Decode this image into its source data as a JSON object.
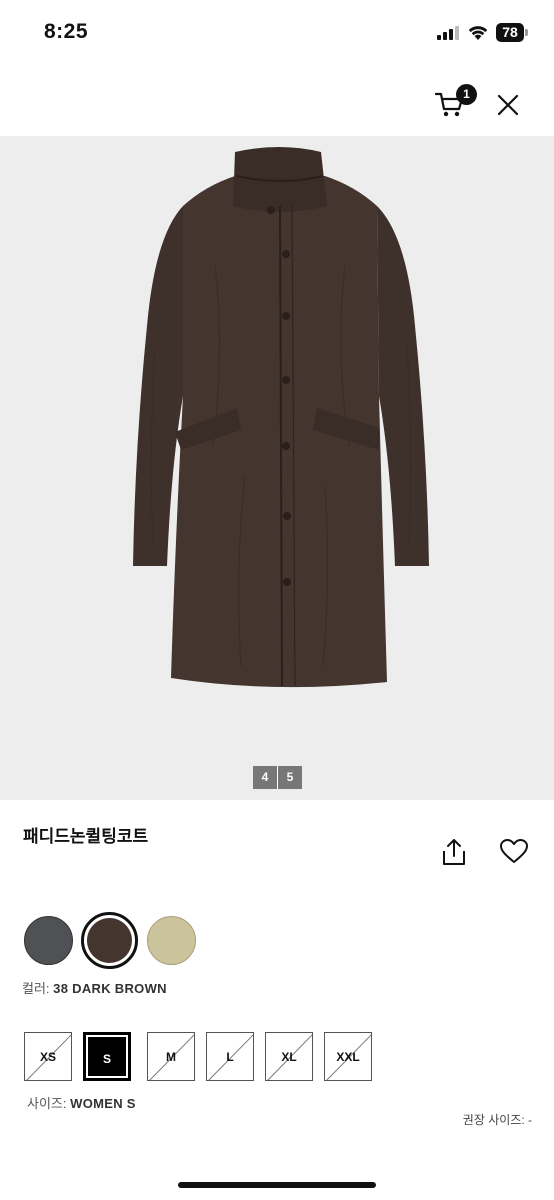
{
  "status_bar": {
    "time": "8:25",
    "battery": "78"
  },
  "header": {
    "cart_count": "1",
    "icons": [
      "cart-icon",
      "close-icon"
    ]
  },
  "gallery": {
    "current": "4",
    "total": "5"
  },
  "product": {
    "title": "패디드논퀼팅코트",
    "icons": [
      "share-icon",
      "heart-icon"
    ],
    "colors": [
      {
        "name": "dark-gray",
        "hex": "#505154",
        "selected": false
      },
      {
        "name": "dark-brown",
        "hex": "#45352f",
        "selected": true
      },
      {
        "name": "beige",
        "hex": "#cbc39c",
        "selected": false
      }
    ],
    "color_label": "컬러:",
    "color_value": "38 DARK BROWN",
    "sizes": [
      {
        "label": "XS",
        "available": false,
        "selected": false
      },
      {
        "label": "S",
        "available": true,
        "selected": true
      },
      {
        "label": "M",
        "available": false,
        "selected": false
      },
      {
        "label": "L",
        "available": false,
        "selected": false
      },
      {
        "label": "XL",
        "available": false,
        "selected": false
      },
      {
        "label": "XXL",
        "available": false,
        "selected": false
      }
    ],
    "size_label": "사이즈:",
    "size_value": "WOMEN S",
    "recommended_size": "권장 사이즈: -"
  }
}
